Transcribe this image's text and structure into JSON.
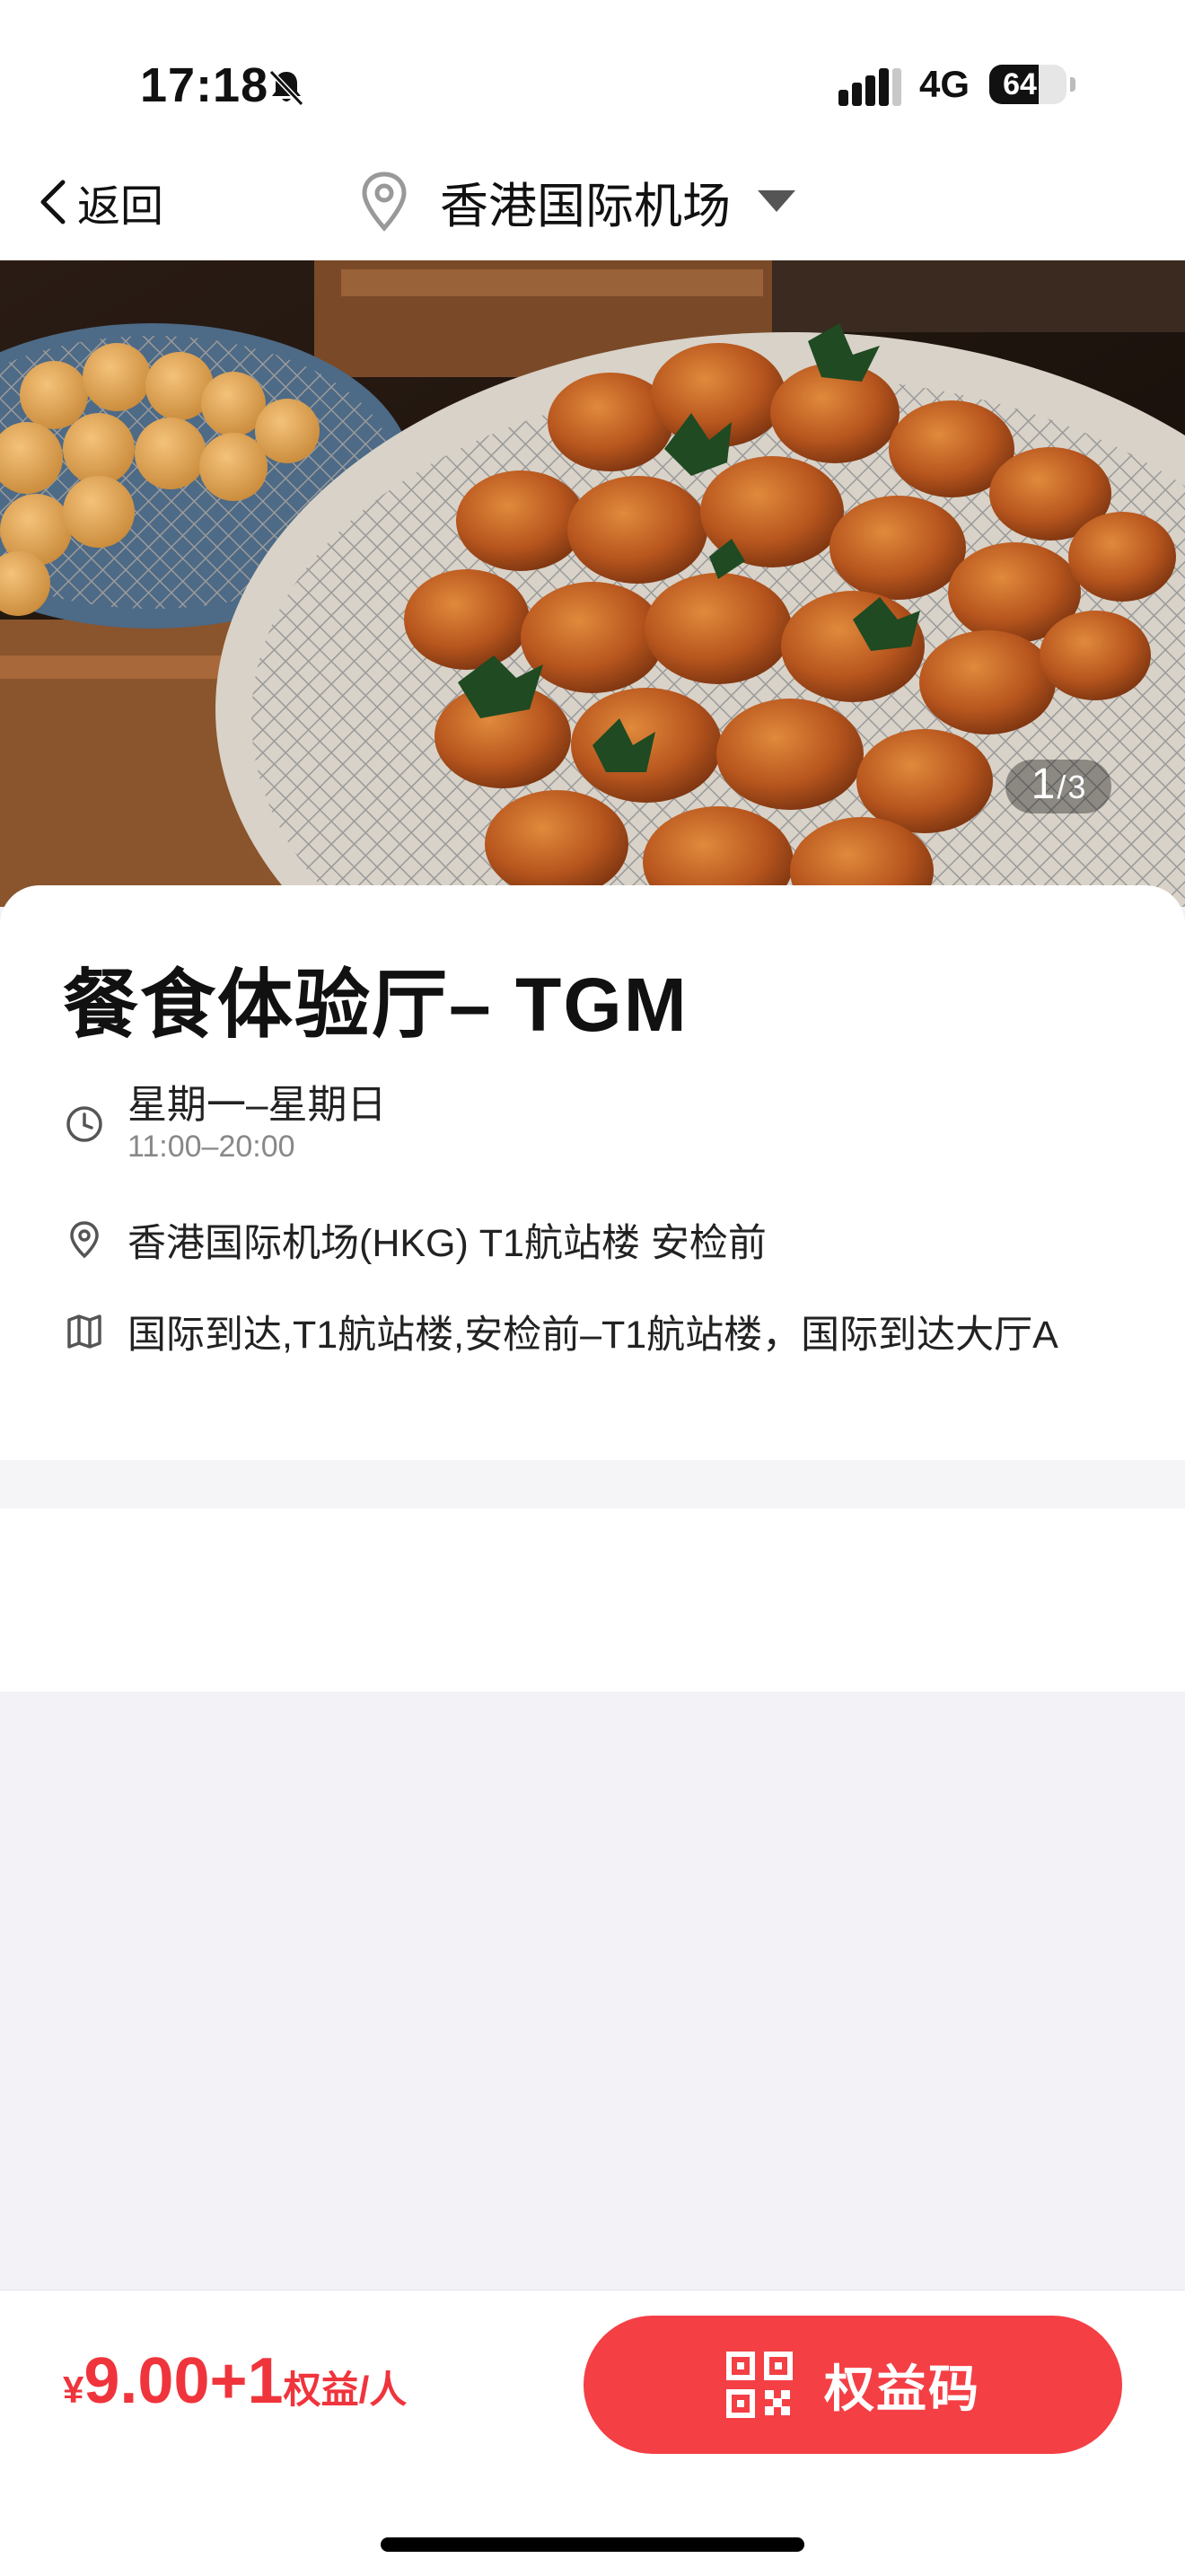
{
  "status_bar": {
    "time": "17:18",
    "network": "4G",
    "battery": "64",
    "battery_level_percent": 64,
    "icons": [
      "bell-slash-icon",
      "signal-icon",
      "battery-icon"
    ]
  },
  "nav": {
    "back_label": "返回",
    "location": "香港国际机场",
    "icons": [
      "chevron-left-icon",
      "map-pin-icon",
      "caret-down-icon"
    ]
  },
  "hero": {
    "current_index": "1",
    "separator": "/",
    "total": "3"
  },
  "lounge": {
    "title": "餐食体验厅– TGM",
    "hours_days": "星期一–星期日",
    "hours_time": "11:00–20:00",
    "address": "香港国际机场(HKG) T1航站楼 安检前",
    "location_detail": "国际到达,T1航站楼,安检前–T1航站楼，国际到达大厅A",
    "icons": [
      "clock-icon",
      "location-pin-icon",
      "map-icon"
    ]
  },
  "footer": {
    "currency": "¥",
    "amount": "9.00+1",
    "unit": "权益/人",
    "button_label": "权益码",
    "button_icon": "qr-code-icon"
  },
  "colors": {
    "accent": "#f43f45",
    "price": "#f0343c",
    "page_background": "#f2f2f7"
  }
}
